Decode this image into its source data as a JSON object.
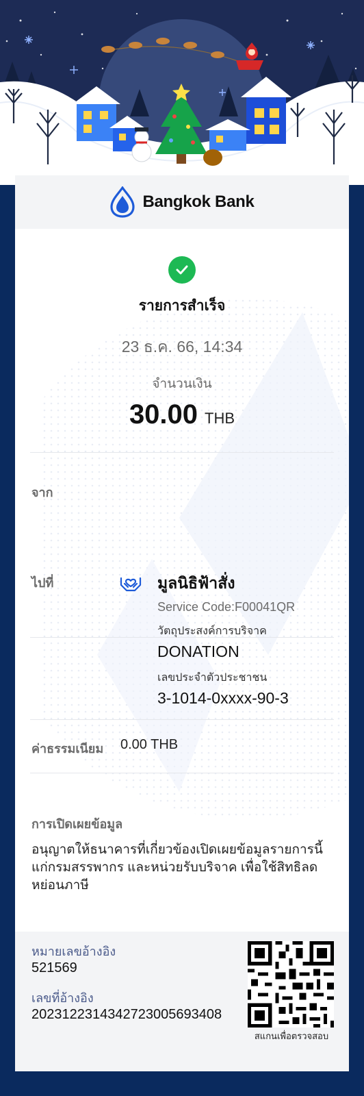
{
  "header": {
    "bank_name": "Bangkok Bank"
  },
  "status": {
    "title": "รายการสำเร็จ",
    "datetime": "23 ธ.ค. 66, 14:34",
    "amount_label": "จำนวนเงิน",
    "amount": "30.00",
    "currency": "THB"
  },
  "from": {
    "label": "จาก"
  },
  "to": {
    "label": "ไปที่",
    "name": "มูลนิธิฟ้าสั่ง",
    "service_code": "Service Code:F00041QR",
    "purpose_label": "วัตถุประสงค์การบริจาค",
    "purpose_value": "DONATION",
    "id_label": "เลขประจำตัวประชาชน",
    "id_value": "3-1014-0xxxx-90-3"
  },
  "fee": {
    "label": "ค่าธรรมเนียม",
    "value": "0.00 THB"
  },
  "disclosure": {
    "title": "การเปิดเผยข้อมูล",
    "text": "อนุญาตให้ธนาคารที่เกี่ยวข้องเปิดเผยข้อมูลรายการนี้แก่กรมสรรพากร และหน่วยรับบริจาค เพื่อใช้สิทธิลดหย่อนภาษี"
  },
  "footer": {
    "ref1_label": "หมายเลขอ้างอิง",
    "ref1_value": "521569",
    "ref2_label": "เลขที่อ้างอิง",
    "ref2_value": "2023122314342723005693408",
    "qr_caption": "สแกนเพื่อตรวจสอบ"
  },
  "colors": {
    "navy_background": "#0a2a5e",
    "brand_blue": "#1e5bd8",
    "success_green": "#1db954",
    "label_gray": "#6b6b6b"
  },
  "icons": {
    "success": "check-circle-icon",
    "recipient": "donation-hands-icon",
    "logo": "bangkok-bank-lotus-logo"
  }
}
